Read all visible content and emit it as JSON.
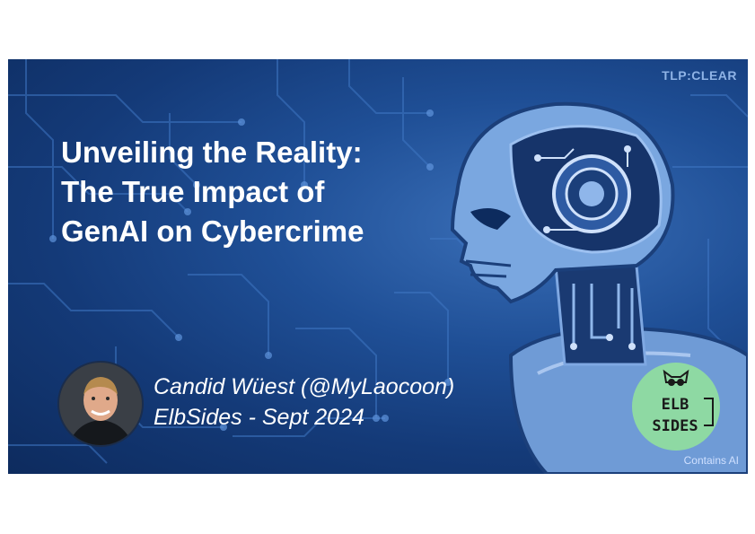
{
  "slide": {
    "tlp_label": "TLP:CLEAR",
    "title_lines": [
      "Unveiling the Reality:",
      "The True Impact of",
      "GenAI on Cybercrime"
    ],
    "speaker_name": "Candid Wüest (@MyLaocoon)",
    "event": "ElbSides - Sept 2024",
    "badge_text_top": "ELB",
    "badge_text_bottom": "SIDES",
    "footer_note": "Contains AI"
  },
  "colors": {
    "background_dark": "#0d2b5e",
    "background_mid": "#1f4f96",
    "robot_blue": "#7aa7e0",
    "title_text": "#ffffff",
    "badge_green": "#8ed9a3"
  }
}
